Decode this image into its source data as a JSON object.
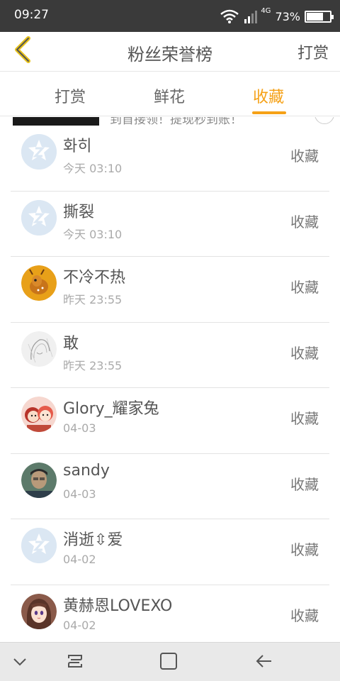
{
  "status_bar": {
    "time": "09:27",
    "network": "4G",
    "battery": "73%",
    "battery_level": 0.73
  },
  "header": {
    "title": "粉丝荣誉榜",
    "right_action": "打赏"
  },
  "tabs": [
    {
      "label": "打赏",
      "active": false
    },
    {
      "label": "鲜花",
      "active": false
    },
    {
      "label": "收藏",
      "active": true
    }
  ],
  "banner": {
    "text": "到首接领！提现秒到账！"
  },
  "list": [
    {
      "name": "화히",
      "time": "今天 03:10",
      "action": "收藏",
      "avatar": "default-avatar-icon"
    },
    {
      "name": "撕裂",
      "time": "今天 03:10",
      "action": "收藏",
      "avatar": "default-avatar-icon"
    },
    {
      "name": "不冷不热",
      "time": "昨天 23:55",
      "action": "收藏",
      "avatar": "fawn-avatar"
    },
    {
      "name": "敢",
      "time": "昨天 23:55",
      "action": "收藏",
      "avatar": "sketch-avatar"
    },
    {
      "name": "Glory_耀家兔",
      "time": "04-03",
      "action": "收藏",
      "avatar": "cartoon-girls-avatar"
    },
    {
      "name": "sandy",
      "time": "04-03",
      "action": "收藏",
      "avatar": "photo-avatar"
    },
    {
      "name": "消逝⇳爱",
      "time": "04-02",
      "action": "收藏",
      "avatar": "default-avatar-icon"
    },
    {
      "name": "黄赫恩LOVEXO",
      "time": "04-02",
      "action": "收藏",
      "avatar": "anime-girl-avatar"
    }
  ],
  "colors": {
    "accent": "#f5a117",
    "status_bar": "#3a3a3a",
    "default_avatar_bg": "#dbe7f3"
  }
}
